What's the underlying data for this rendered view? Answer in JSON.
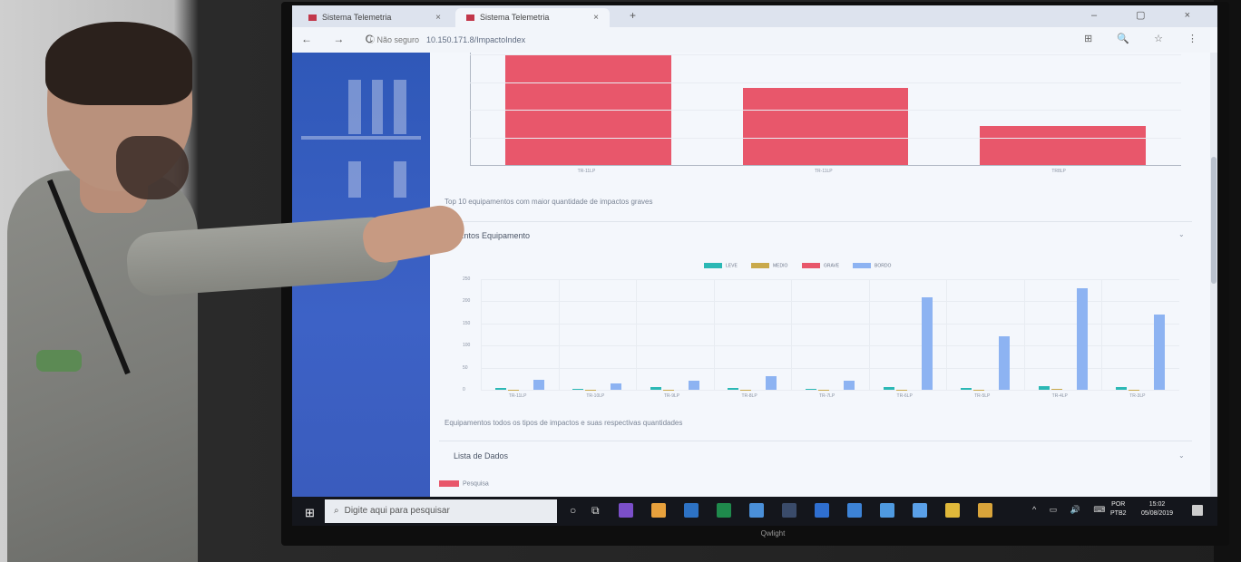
{
  "browser": {
    "tabs": [
      {
        "label": "Sistema Telemetria"
      },
      {
        "label": "Sistema Telemetria"
      }
    ],
    "new_tab_glyph": "+",
    "window_controls": "– ▢ ×",
    "nav_glyphs": "← → C",
    "security_label": "ⓘ Não seguro",
    "url": "10.150.171.8/ImpactoIndex",
    "toolbar_glyphs": "⊞ 🔍 ☆ ⋮"
  },
  "page": {
    "top_chart_caption": "Top 10 equipamentos com maior quantidade de impactos graves",
    "second_card_title": "...ntos Equipamento",
    "second_chart_caption": "Equipamentos todos os tipos de impactos e suas respectivas quantidades",
    "third_card_title": "Lista de Dados",
    "third_card_legend_label": "Pesquisa",
    "card_chevron": "⌄"
  },
  "chart_data": [
    {
      "type": "bar",
      "categories": [
        "TR-11LP",
        "TR-11LP",
        "TR8LP"
      ],
      "values": [
        10,
        7,
        3.5
      ],
      "color": "#e8576b",
      "grid": true
    },
    {
      "type": "bar",
      "legend_placement": "top",
      "categories": [
        "TR-11LP",
        "TR-10LP",
        "TR-9LP",
        "TR-8LP",
        "TR-7LP",
        "TR-6LP",
        "TR-5LP",
        "TR-4LP",
        "TR-3LP"
      ],
      "series": [
        {
          "name": "LEVE",
          "color": "#2bb8b5",
          "values": [
            5,
            3,
            6,
            5,
            3,
            6,
            5,
            8,
            6
          ]
        },
        {
          "name": "MEDIO",
          "color": "#c9a94b",
          "values": [
            1,
            1,
            1,
            1,
            1,
            1,
            1,
            2,
            1
          ]
        },
        {
          "name": "GRAVE",
          "color": "#e8576b",
          "values": [
            0,
            0,
            0,
            0,
            0,
            0,
            0,
            0,
            0
          ]
        },
        {
          "name": "BORDO",
          "color": "#8db3f2",
          "values": [
            22,
            14,
            20,
            30,
            20,
            210,
            120,
            230,
            170
          ]
        }
      ],
      "ylim": [
        0,
        250
      ],
      "yticks": [
        "0",
        "50",
        "100",
        "150",
        "200",
        "250"
      ],
      "grid": true
    }
  ],
  "taskbar": {
    "start_glyph": "⊞",
    "search_glyph": "⌕",
    "search_placeholder": "Digite aqui para pesquisar",
    "cortana_glyph": "○",
    "taskview_glyph": "⧉",
    "apps": [
      {
        "name": "visual-studio",
        "color": "#7b4fc9"
      },
      {
        "name": "chrome",
        "color": "#e8a13c"
      },
      {
        "name": "outlook",
        "color": "#2d72c4"
      },
      {
        "name": "excel",
        "color": "#1f8a4c"
      },
      {
        "name": "app-blue",
        "color": "#4a8fd8"
      },
      {
        "name": "calculator",
        "color": "#3a4b6a"
      },
      {
        "name": "app-blue-2",
        "color": "#2f6fd0"
      },
      {
        "name": "remote",
        "color": "#3d83d6"
      },
      {
        "name": "app-globe",
        "color": "#4f9ae0"
      },
      {
        "name": "app-people",
        "color": "#5aa0e8"
      },
      {
        "name": "explorer",
        "color": "#e0b83a"
      },
      {
        "name": "app-grid",
        "color": "#d9a43a"
      }
    ],
    "tray_glyphs": "^ ▭ 🔊 ⌨",
    "lang_line1": "POR",
    "lang_line2": "PTB2",
    "time": "15:02",
    "date": "05/08/2019"
  },
  "monitor_brand": "Qwlight"
}
